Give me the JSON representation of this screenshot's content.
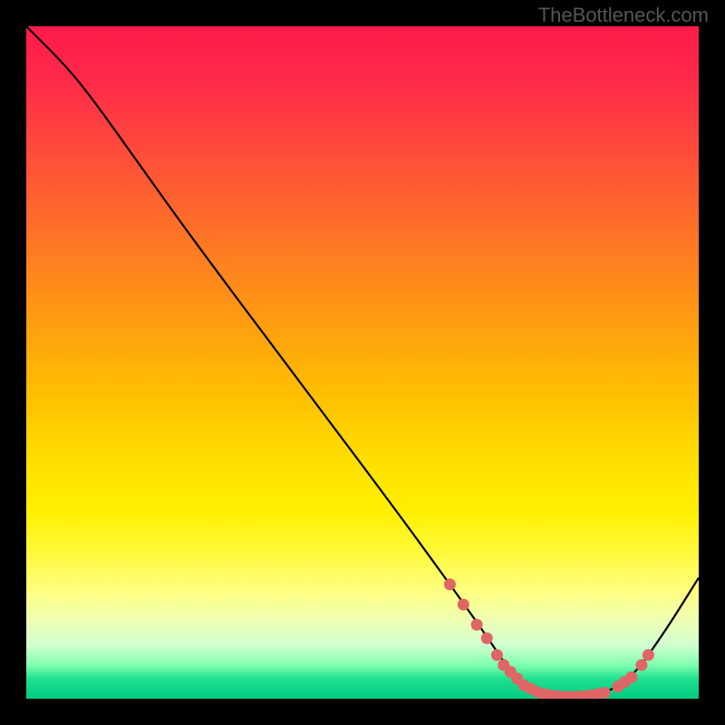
{
  "attribution": "TheBottleneck.com",
  "chart_data": {
    "type": "line",
    "title": "",
    "xlabel": "",
    "ylabel": "",
    "x_range": [
      0,
      100
    ],
    "y_range": [
      0,
      100
    ],
    "curve_points": [
      {
        "x": 0,
        "y": 100
      },
      {
        "x": 6,
        "y": 94
      },
      {
        "x": 10,
        "y": 89
      },
      {
        "x": 15,
        "y": 82
      },
      {
        "x": 25,
        "y": 68
      },
      {
        "x": 40,
        "y": 48
      },
      {
        "x": 55,
        "y": 28
      },
      {
        "x": 63,
        "y": 17
      },
      {
        "x": 68,
        "y": 10
      },
      {
        "x": 72,
        "y": 4
      },
      {
        "x": 75,
        "y": 1.5
      },
      {
        "x": 78,
        "y": 0.5
      },
      {
        "x": 82,
        "y": 0.3
      },
      {
        "x": 86,
        "y": 0.8
      },
      {
        "x": 90,
        "y": 3
      },
      {
        "x": 95,
        "y": 10
      },
      {
        "x": 100,
        "y": 18
      }
    ],
    "marker_points": [
      {
        "x": 63,
        "y": 17
      },
      {
        "x": 65,
        "y": 14
      },
      {
        "x": 67,
        "y": 11
      },
      {
        "x": 68.5,
        "y": 9
      },
      {
        "x": 70,
        "y": 6.5
      },
      {
        "x": 71,
        "y": 5
      },
      {
        "x": 72,
        "y": 4
      },
      {
        "x": 73,
        "y": 3
      },
      {
        "x": 74,
        "y": 2
      },
      {
        "x": 75,
        "y": 1.5
      },
      {
        "x": 76,
        "y": 1
      },
      {
        "x": 77,
        "y": 0.7
      },
      {
        "x": 78,
        "y": 0.5
      },
      {
        "x": 79,
        "y": 0.4
      },
      {
        "x": 80,
        "y": 0.3
      },
      {
        "x": 81,
        "y": 0.3
      },
      {
        "x": 82,
        "y": 0.3
      },
      {
        "x": 83,
        "y": 0.4
      },
      {
        "x": 84,
        "y": 0.5
      },
      {
        "x": 85,
        "y": 0.7
      },
      {
        "x": 86,
        "y": 0.9
      },
      {
        "x": 88,
        "y": 1.8
      },
      {
        "x": 89,
        "y": 2.5
      },
      {
        "x": 90,
        "y": 3.2
      },
      {
        "x": 91.5,
        "y": 5
      },
      {
        "x": 92.5,
        "y": 6.5
      }
    ],
    "gradient_colors": {
      "top": "#ff1a4a",
      "mid_upper": "#ff8020",
      "mid": "#ffe000",
      "mid_lower": "#f0ffb0",
      "bottom": "#00cc80"
    },
    "marker_color": "#e06565",
    "line_color": "#000000"
  }
}
